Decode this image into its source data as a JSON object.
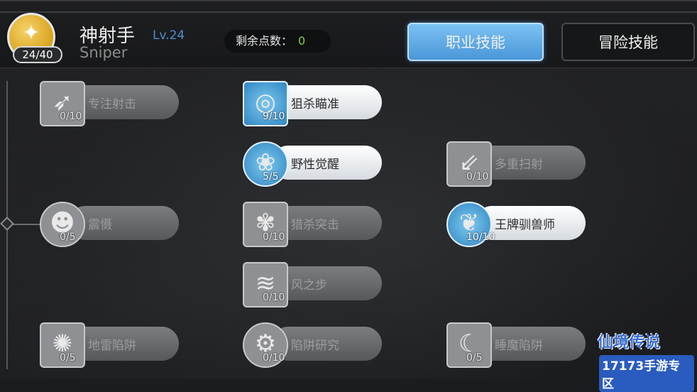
{
  "header": {
    "skill_points": "24/40",
    "class_name": "神射手",
    "class_level": "Lv.24",
    "class_name_en": "Sniper",
    "remaining_label": "剩余点数：",
    "remaining_value": "0",
    "tabs": [
      {
        "label": "职业技能",
        "active": true
      },
      {
        "label": "冒险技能",
        "active": false
      }
    ]
  },
  "skills": [
    {
      "name": "专注射击",
      "count": "0/10",
      "active": false,
      "icon": "focus-shot-icon"
    },
    {
      "name": "狙杀瞄准",
      "count": "9/10",
      "active": true,
      "icon": "crosshair-icon"
    },
    {
      "name": "野性觉醒",
      "count": "5/5",
      "active": true,
      "icon": "paw-icon"
    },
    {
      "name": "多重扫射",
      "count": "0/10",
      "active": false,
      "icon": "multi-arrow-icon"
    },
    {
      "name": "震慑",
      "count": "0/5",
      "active": false,
      "icon": "roar-icon"
    },
    {
      "name": "猎杀突击",
      "count": "0/10",
      "active": false,
      "icon": "beast-strike-icon"
    },
    {
      "name": "王牌驯兽师",
      "count": "10/10",
      "active": true,
      "icon": "eagle-icon"
    },
    {
      "name": "风之步",
      "count": "0/10",
      "active": false,
      "icon": "wind-step-icon"
    },
    {
      "name": "地雷陷阱",
      "count": "0/5",
      "active": false,
      "icon": "mine-trap-icon"
    },
    {
      "name": "陷阱研究",
      "count": "0/10",
      "active": false,
      "icon": "trap-research-icon"
    },
    {
      "name": "睡魔陷阱",
      "count": "0/5",
      "active": false,
      "icon": "sleep-trap-icon"
    }
  ],
  "watermark": {
    "title": "仙境传说",
    "subtitle": "17173手游专区"
  }
}
